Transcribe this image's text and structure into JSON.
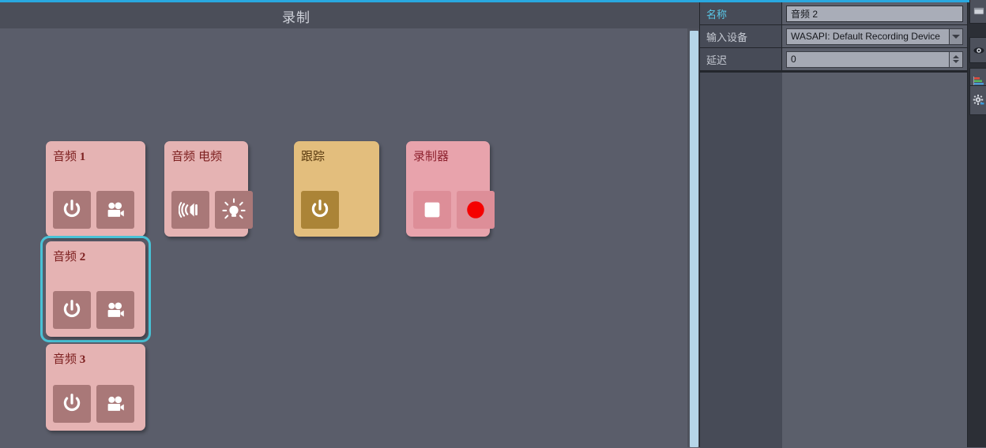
{
  "window": {
    "title": "录制",
    "accent_color": "#29a8e0",
    "titlebar_color": "#4b4e59",
    "background_color": "#5a5d6a"
  },
  "canvas": {
    "cards": [
      {
        "id": "audio-1",
        "title_text": "音频",
        "title_num": "1",
        "theme": "pink",
        "selected": false,
        "buttons": [
          {
            "icon": "power-icon",
            "label": "电源"
          },
          {
            "icon": "video-camera-icon",
            "label": "摄像机"
          }
        ]
      },
      {
        "id": "audio-electric",
        "title_text": "音频 电频",
        "title_num": "",
        "theme": "pink",
        "selected": false,
        "buttons": [
          {
            "icon": "speaker-icon",
            "label": "扬声器"
          },
          {
            "icon": "lightbulb-icon",
            "label": "灯泡"
          }
        ]
      },
      {
        "id": "tracking",
        "title_text": "跟踪",
        "title_num": "",
        "theme": "tan",
        "selected": false,
        "buttons": [
          {
            "icon": "power-icon",
            "label": "电源"
          }
        ]
      },
      {
        "id": "recorder",
        "title_text": "录制器",
        "title_num": "",
        "theme": "pink2",
        "selected": false,
        "buttons": [
          {
            "icon": "stop-square-icon",
            "label": "停止"
          },
          {
            "icon": "record-circle-icon",
            "label": "录制"
          }
        ]
      },
      {
        "id": "audio-2",
        "title_text": "音频",
        "title_num": "2",
        "theme": "pink",
        "selected": true,
        "buttons": [
          {
            "icon": "power-icon",
            "label": "电源"
          },
          {
            "icon": "video-camera-icon",
            "label": "摄像机"
          }
        ]
      },
      {
        "id": "audio-3",
        "title_text": "音频",
        "title_num": "3",
        "theme": "pink",
        "selected": false,
        "buttons": [
          {
            "icon": "power-icon",
            "label": "电源"
          },
          {
            "icon": "video-camera-icon",
            "label": "摄像机"
          }
        ]
      }
    ],
    "selection_color": "#49c2d6"
  },
  "inspector": {
    "rows": [
      {
        "label": "名称",
        "label_active": true,
        "type": "text",
        "value": "音频 2"
      },
      {
        "label": "输入设备",
        "label_active": false,
        "type": "combo",
        "value": "WASAPI: Default Recording Device"
      },
      {
        "label": "延迟",
        "label_active": false,
        "type": "spinner",
        "value": "0"
      }
    ],
    "active_label_color": "#59c8e8"
  },
  "icon_strip": {
    "items": [
      {
        "icon": "window-icon",
        "label": "窗口"
      },
      {
        "icon": "eye-icon",
        "label": "预览"
      },
      {
        "icon": "mixer-bars-icon",
        "label": "混音器"
      },
      {
        "icon": "gear-icon",
        "label": "设置"
      }
    ]
  },
  "scrollbar": {
    "orientation": "vertical",
    "thumb_color": "#b6d5e8"
  }
}
